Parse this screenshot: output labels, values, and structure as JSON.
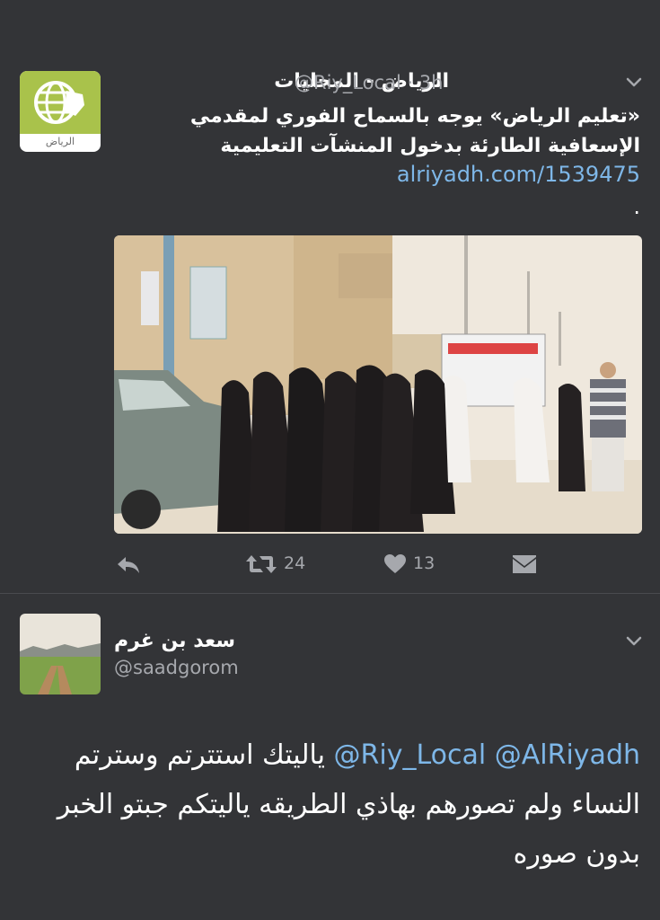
{
  "tweet1": {
    "display_name": "الرياض - المحليات",
    "handle": "@Riy_Local",
    "time": "· 3h",
    "avatar_caption": "الرياض",
    "text_line1": "«تعليم الرياض» يوجه بالسماح الفوري لمقدمي",
    "text_line2": "الإسعافية الطارئة بدخول المنشآت التعليمية",
    "link": "alriyadh.com/1539475",
    "trailing": ".",
    "retweets": "24",
    "likes": "13"
  },
  "tweet2": {
    "display_name": "سعد بن غرم",
    "handle": "@saadgorom",
    "mention1": "@AlRiyadh",
    "mention2": "@Riy_Local",
    "text_line1_rest": "ياليتك استترتم وسترتم",
    "text_line2": "النساء ولم تصورهم بهاذي الطريقه ياليتكم جبتو الخبر",
    "text_line3": "بدون صوره"
  },
  "colors": {
    "background": "#333437",
    "link": "#7eb7e8",
    "secondary_text": "#a6a8ad",
    "avatar_green": "#a9c24b"
  },
  "icons": [
    "reply-icon",
    "retweet-icon",
    "heart-icon",
    "direct-message-icon",
    "chevron-down-icon",
    "globe-logo-icon"
  ]
}
